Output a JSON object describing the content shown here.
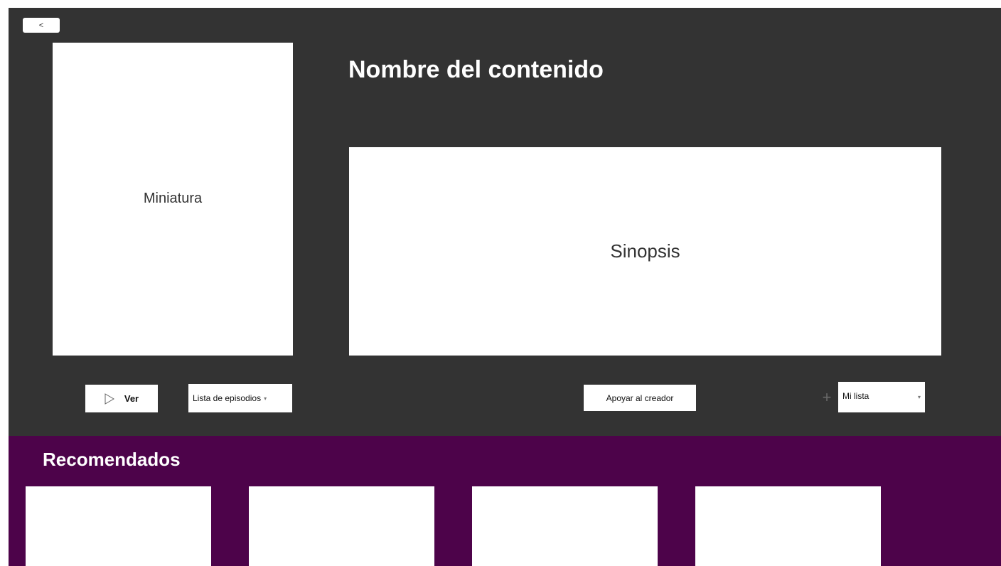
{
  "navigation": {
    "back_label": "<"
  },
  "content": {
    "title": "Nombre del contenido",
    "thumbnail_label": "Miniatura",
    "synopsis_label": "Sinopsis"
  },
  "actions": {
    "watch_label": "Ver",
    "watch_icon": "play-icon",
    "episodes_label": "Lista de episodios",
    "episodes_icon": "chevron-down-icon",
    "support_label": "Apoyar al creador",
    "add_icon": "plus-icon",
    "mylist_label": "Mi lista",
    "mylist_icon": "chevron-down-icon"
  },
  "recommended": {
    "title": "Recomendados",
    "items": [
      "",
      "",
      "",
      ""
    ]
  },
  "colors": {
    "top_background": "#333333",
    "bottom_background": "#4d034a",
    "panel": "#ffffff"
  }
}
